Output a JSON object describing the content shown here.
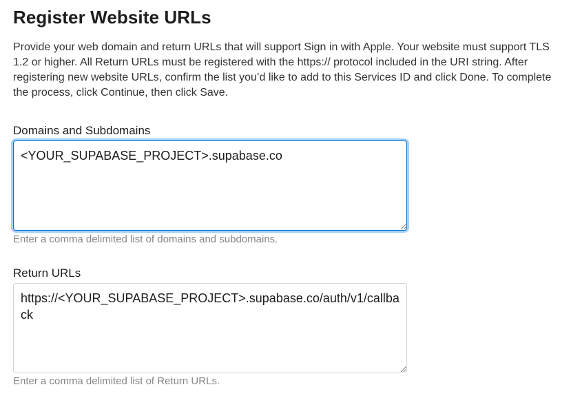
{
  "page": {
    "title": "Register Website URLs",
    "intro": "Provide your web domain and return URLs that will support Sign in with Apple. Your website must support TLS 1.2 or higher. All Return URLs must be registered with the https:// protocol included in the URI string. After registering new website URLs, confirm the list you’d like to add to this Services ID and click Done. To complete the process, click Continue, then click Save."
  },
  "domains": {
    "label": "Domains and Subdomains",
    "value": "<YOUR_SUPABASE_PROJECT>.supabase.co",
    "hint": "Enter a comma delimited list of domains and subdomains."
  },
  "return_urls": {
    "label": "Return URLs",
    "value": "https://<YOUR_SUPABASE_PROJECT>.supabase.co/auth/v1/callback",
    "hint": "Enter a comma delimited list of Return URLs."
  },
  "colors": {
    "focus_border": "#0070c9",
    "hint_text": "#86868b",
    "body_text": "#333333"
  }
}
